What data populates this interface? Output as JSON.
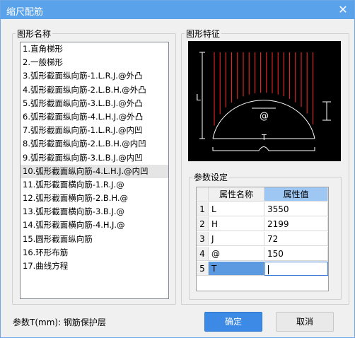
{
  "window": {
    "title": "缩尺配筋",
    "close_glyph": "✕"
  },
  "left_panel": {
    "legend": "图形名称",
    "items": [
      "1.直角梯形",
      "2.一般梯形",
      "3.弧形截面纵向筋-1.L.R.J.@外凸",
      "4.弧形截面纵向筋-2.L.B.H.@外凸",
      "5.弧形截面纵向筋-3.L.B.J.@外凸",
      "6.弧形截面纵向筋-4.L.H.J.@外凸",
      "7.弧形截面纵向筋-1.L.R.J.@内凹",
      "8.弧形截面纵向筋-2.L.B.H.@内凹",
      "9.弧形截面纵向筋-3.L.B.J.@内凹",
      "10.弧形截面纵向筋-4.L.H.J.@内凹",
      "11.弧形截面横向筋-1.R.J.@",
      "12.弧形截面横向筋-2.B.H.@",
      "13.弧形截面横向筋-3.B.J.@",
      "14.弧形截面横向筋-4.H.J.@",
      "15.圆形截面纵向筋",
      "16.环形布筋",
      "17.曲线方程"
    ],
    "selected_index": 9
  },
  "right_panel": {
    "legend": "图形特征",
    "preview": {
      "label_l": "L",
      "label_at": "@",
      "label_t": "T",
      "line_color": "#ff2a2a"
    }
  },
  "params": {
    "legend": "参数设定",
    "headers": [
      "属性名称",
      "属性值"
    ],
    "rows": [
      {
        "index": "1",
        "name": "L",
        "value": "3550"
      },
      {
        "index": "2",
        "name": "H",
        "value": "2199"
      },
      {
        "index": "3",
        "name": "J",
        "value": "72"
      },
      {
        "index": "4",
        "name": "@",
        "value": "150"
      },
      {
        "index": "5",
        "name": "T",
        "value": ""
      }
    ],
    "active_row": 4
  },
  "status_text": "参数T(mm): 钢筋保护层",
  "buttons": {
    "ok": "确定",
    "cancel": "取消"
  },
  "colors": {
    "titlebar": "#5aa2ea",
    "ok_button": "#3c8ae6",
    "value_header": "#9ec8f3",
    "active_name_cell": "#5b9ae0"
  }
}
